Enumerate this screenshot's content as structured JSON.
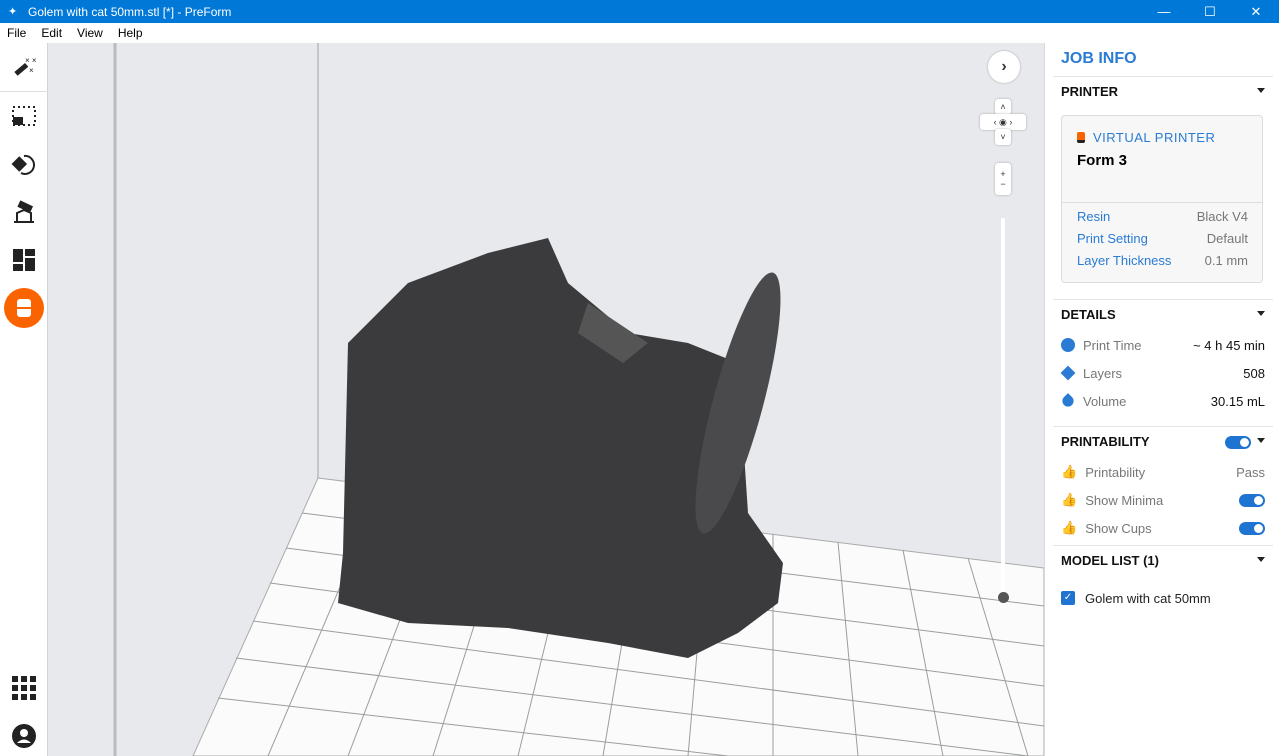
{
  "window": {
    "title": "Golem with cat 50mm.stl [*] - PreForm",
    "minimize": "—",
    "maximize": "☐",
    "close": "✕"
  },
  "menu": [
    "File",
    "Edit",
    "View",
    "Help"
  ],
  "toolbar": [
    "magic-wand",
    "select",
    "orient",
    "supports",
    "layout",
    "print"
  ],
  "panel": {
    "title": "JOB INFO",
    "printer": {
      "header": "PRINTER",
      "type": "VIRTUAL PRINTER",
      "name": "Form 3",
      "rows": [
        {
          "k": "Resin",
          "v": "Black V4"
        },
        {
          "k": "Print Setting",
          "v": "Default"
        },
        {
          "k": "Layer Thickness",
          "v": "0.1 mm"
        }
      ]
    },
    "details": {
      "header": "DETAILS",
      "rows": [
        {
          "k": "Print Time",
          "v": "~ 4 h 45 min"
        },
        {
          "k": "Layers",
          "v": "508"
        },
        {
          "k": "Volume",
          "v": "30.15 mL"
        }
      ]
    },
    "printability": {
      "header": "PRINTABILITY",
      "enabled": true,
      "rows": [
        {
          "k": "Printability",
          "v": "Pass"
        },
        {
          "k": "Show Minima",
          "on": true
        },
        {
          "k": "Show Cups",
          "on": true
        }
      ]
    },
    "models": {
      "header": "MODEL LIST (1)",
      "items": [
        {
          "name": "Golem with cat 50mm",
          "checked": true
        }
      ]
    }
  },
  "colors": {
    "accent": "#2a7bd4",
    "titlebar": "#0078d7",
    "print": "#fa6400",
    "pass": "#2ea836"
  }
}
